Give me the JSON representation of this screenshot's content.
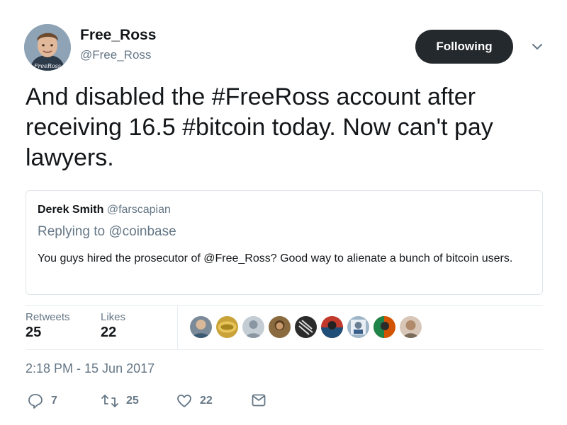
{
  "author": {
    "name": "Free_Ross",
    "handle": "@Free_Ross",
    "avatar_caption": "FreeRoss"
  },
  "follow_button": {
    "label": "Following"
  },
  "tweet": {
    "text": "And disabled the #FreeRoss account after receiving 16.5 #bitcoin today. Now can't pay lawyers."
  },
  "quoted_tweet": {
    "name": "Derek Smith",
    "handle": "@farscapian",
    "replying_prefix": "Replying to ",
    "replying_to": "@coinbase",
    "text": "You guys hired the prosecutor of @Free_Ross?  Good way to alienate a bunch of bitcoin users."
  },
  "stats": {
    "retweets_label": "Retweets",
    "retweets_value": "25",
    "likes_label": "Likes",
    "likes_value": "22"
  },
  "liker_avatars": [
    {
      "icon": "avatar-1",
      "color": "#7a8a99"
    },
    {
      "icon": "avatar-2",
      "color": "#c9a33a"
    },
    {
      "icon": "avatar-3",
      "color": "#c4ccd4"
    },
    {
      "icon": "avatar-4",
      "color": "#8a6b3f"
    },
    {
      "icon": "avatar-5",
      "color": "#2b2b2b"
    },
    {
      "icon": "avatar-6",
      "color": "#c0392b"
    },
    {
      "icon": "avatar-7",
      "color": "#9fb5c8"
    },
    {
      "icon": "avatar-8",
      "color": "#d35400"
    },
    {
      "icon": "avatar-9",
      "color": "#d8c7b8"
    }
  ],
  "timestamp": "2:18 PM - 15 Jun 2017",
  "actions": {
    "reply_count": "7",
    "retweet_count": "25",
    "like_count": "22",
    "reply_icon": "reply-icon",
    "retweet_icon": "retweet-icon",
    "like_icon": "heart-icon",
    "dm_icon": "envelope-icon"
  },
  "colors": {
    "text": "#14171a",
    "secondary": "#657786",
    "button": "#24292e",
    "border": "#e6ecf0"
  }
}
